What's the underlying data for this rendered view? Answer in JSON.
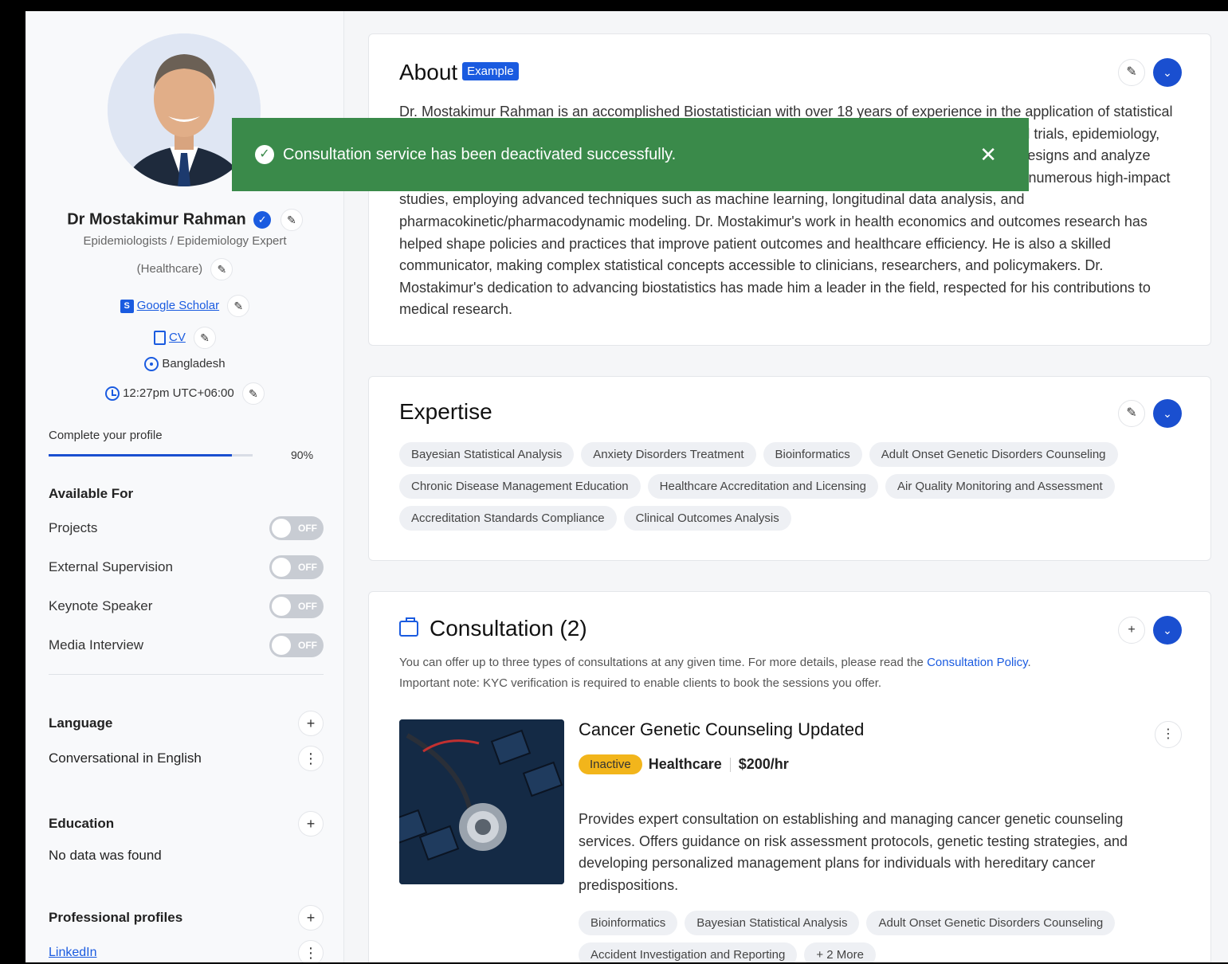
{
  "toast": {
    "message": "Consultation service has been deactivated successfully.",
    "close_label": "✕"
  },
  "profile": {
    "name": "Dr Mostakimur Rahman",
    "title_line1": "Epidemiologists / Epidemiology Expert",
    "title_line2": "(Healthcare)",
    "google_scholar_label": "Google Scholar",
    "cv_label": "CV",
    "location": "Bangladesh",
    "time": "12:27pm UTC+06:00"
  },
  "progress": {
    "label": "Complete your profile",
    "value_text": "90%",
    "fraction": 0.9
  },
  "available_for": {
    "title": "Available For",
    "toggle_text": "OFF",
    "items": [
      {
        "label": "Projects"
      },
      {
        "label": "External Supervision"
      },
      {
        "label": "Keynote Speaker"
      },
      {
        "label": "Media Interview"
      }
    ]
  },
  "language": {
    "title": "Language",
    "value": "Conversational in English"
  },
  "education": {
    "title": "Education",
    "value": "No data was found"
  },
  "professional_profiles": {
    "title": "Professional profiles",
    "value": "LinkedIn"
  },
  "about": {
    "title": "About",
    "badge": "Example",
    "text": "Dr. Mostakimur Rahman is an accomplished Biostatistician with over 18 years of experience in the application of statistical methods to medical and public health research. His expertise spans multiple areas including clinical trials, epidemiology, and health economics, where he has worked closely with research teams to develop robust study designs and analyze complex datasets, and to support data-driven decision-making in healthcare. He has contributed to numerous high-impact studies, employing advanced techniques such as machine learning, longitudinal data analysis, and pharmacokinetic/pharmacodynamic modeling. Dr. Mostakimur's work in health economics and outcomes research has helped shape policies and practices that improve patient outcomes and healthcare efficiency. He is also a skilled communicator, making complex statistical concepts accessible to clinicians, researchers, and policymakers. Dr. Mostakimur's dedication to advancing biostatistics has made him a leader in the field, respected for his contributions to medical research."
  },
  "expertise": {
    "title": "Expertise",
    "tags": [
      "Bayesian Statistical Analysis",
      "Anxiety Disorders Treatment",
      "Bioinformatics",
      "Adult Onset Genetic Disorders Counseling",
      "Chronic Disease Management Education",
      "Healthcare Accreditation and Licensing",
      "Air Quality Monitoring and Assessment",
      "Accreditation Standards Compliance",
      "Clinical Outcomes Analysis"
    ]
  },
  "consultation": {
    "title": "Consultation (2)",
    "note_prefix": "You can offer up to three types of consultations at any given time. For more details, please read the ",
    "policy_link": "Consultation Policy",
    "note_suffix": ".",
    "note_line2": "Important note: KYC verification is required to enable clients to book the sessions you offer.",
    "item": {
      "name": "Cancer Genetic Counseling Updated",
      "status": "Inactive",
      "category": "Healthcare",
      "rate": "$200/hr",
      "description": "Provides expert consultation on establishing and managing cancer genetic counseling services. Offers guidance on risk assessment protocols, genetic testing strategies, and developing personalized management plans for individuals with hereditary cancer predispositions.",
      "tags": [
        "Bioinformatics",
        "Bayesian Statistical Analysis",
        "Adult Onset Genetic Disorders Counseling",
        "Accident Investigation and Reporting",
        "+ 2 More"
      ]
    }
  },
  "colors": {
    "accent": "#1a4fd0",
    "toast": "#3a8a4a",
    "inactive": "#f2b51b"
  }
}
